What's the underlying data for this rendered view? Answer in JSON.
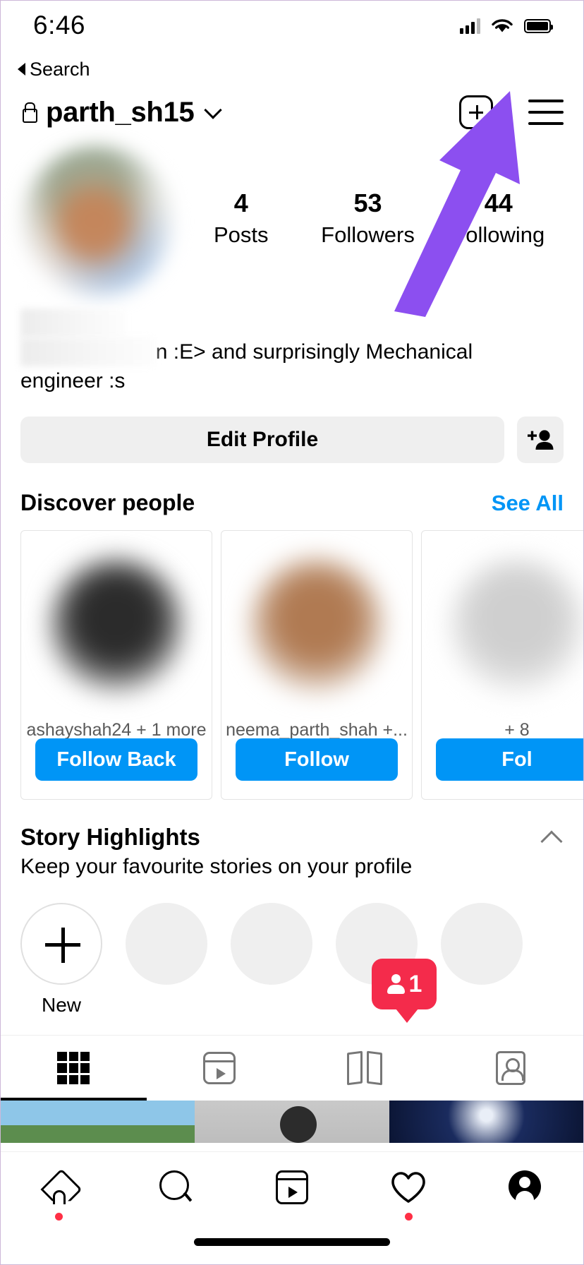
{
  "status_bar": {
    "time": "6:46",
    "signal_icon": "cellular-signal-icon",
    "wifi_icon": "wifi-icon",
    "battery_icon": "battery-icon",
    "back_label": "Search"
  },
  "header": {
    "lock_icon": "lock-icon",
    "username": "parth_sh15",
    "dropdown_icon": "chevron-down-icon",
    "add_icon": "plus-box-icon",
    "menu_icon": "hamburger-menu-icon"
  },
  "profile": {
    "avatar": "profile-avatar-blurred",
    "stats": [
      {
        "num": "4",
        "label": "Posts"
      },
      {
        "num": "53",
        "label": "Followers"
      },
      {
        "num": "44",
        "label": "Following"
      }
    ],
    "bio": {
      "line1": "",
      "line2": "n :E> and surprisingly Mechanical",
      "line3": "engineer :s"
    },
    "edit_profile_label": "Edit Profile",
    "add_person_icon": "add-person-icon"
  },
  "discover": {
    "title": "Discover people",
    "see_all_label": "See All",
    "cards": [
      {
        "name": "ashayshah24 + 1 more",
        "button": "Follow Back"
      },
      {
        "name": "neema_parth_shah +...",
        "button": "Follow"
      },
      {
        "name": "+ 8 ",
        "button": "Fol"
      }
    ]
  },
  "story_highlights": {
    "title": "Story Highlights",
    "subtitle": "Keep your favourite stories on your profile",
    "collapse_icon": "chevron-up-icon",
    "new_label": "New",
    "empty_count": 4
  },
  "tabs": [
    {
      "name": "grid-tab",
      "icon": "grid-icon",
      "active": true
    },
    {
      "name": "reels-tab",
      "icon": "reels-icon",
      "active": false
    },
    {
      "name": "guides-tab",
      "icon": "guides-icon",
      "active": false
    },
    {
      "name": "tagged-tab",
      "icon": "tagged-icon",
      "active": false
    }
  ],
  "notification_badge": {
    "count": "1",
    "icon": "person-icon",
    "color": "#f42b4b"
  },
  "bottom_nav": [
    {
      "name": "home",
      "icon": "home-icon",
      "dot": true
    },
    {
      "name": "search",
      "icon": "search-icon",
      "dot": false
    },
    {
      "name": "reels",
      "icon": "reels-icon",
      "dot": false
    },
    {
      "name": "likes",
      "icon": "heart-icon",
      "dot": true
    },
    {
      "name": "profile",
      "icon": "profile-icon",
      "dot": false
    }
  ],
  "annotation": {
    "arrow_color": "#8c4ff0",
    "points_to": "hamburger-menu-icon"
  },
  "colors": {
    "accent_blue": "#0095f6",
    "badge_red": "#f42b4b",
    "button_grey": "#efefef"
  }
}
